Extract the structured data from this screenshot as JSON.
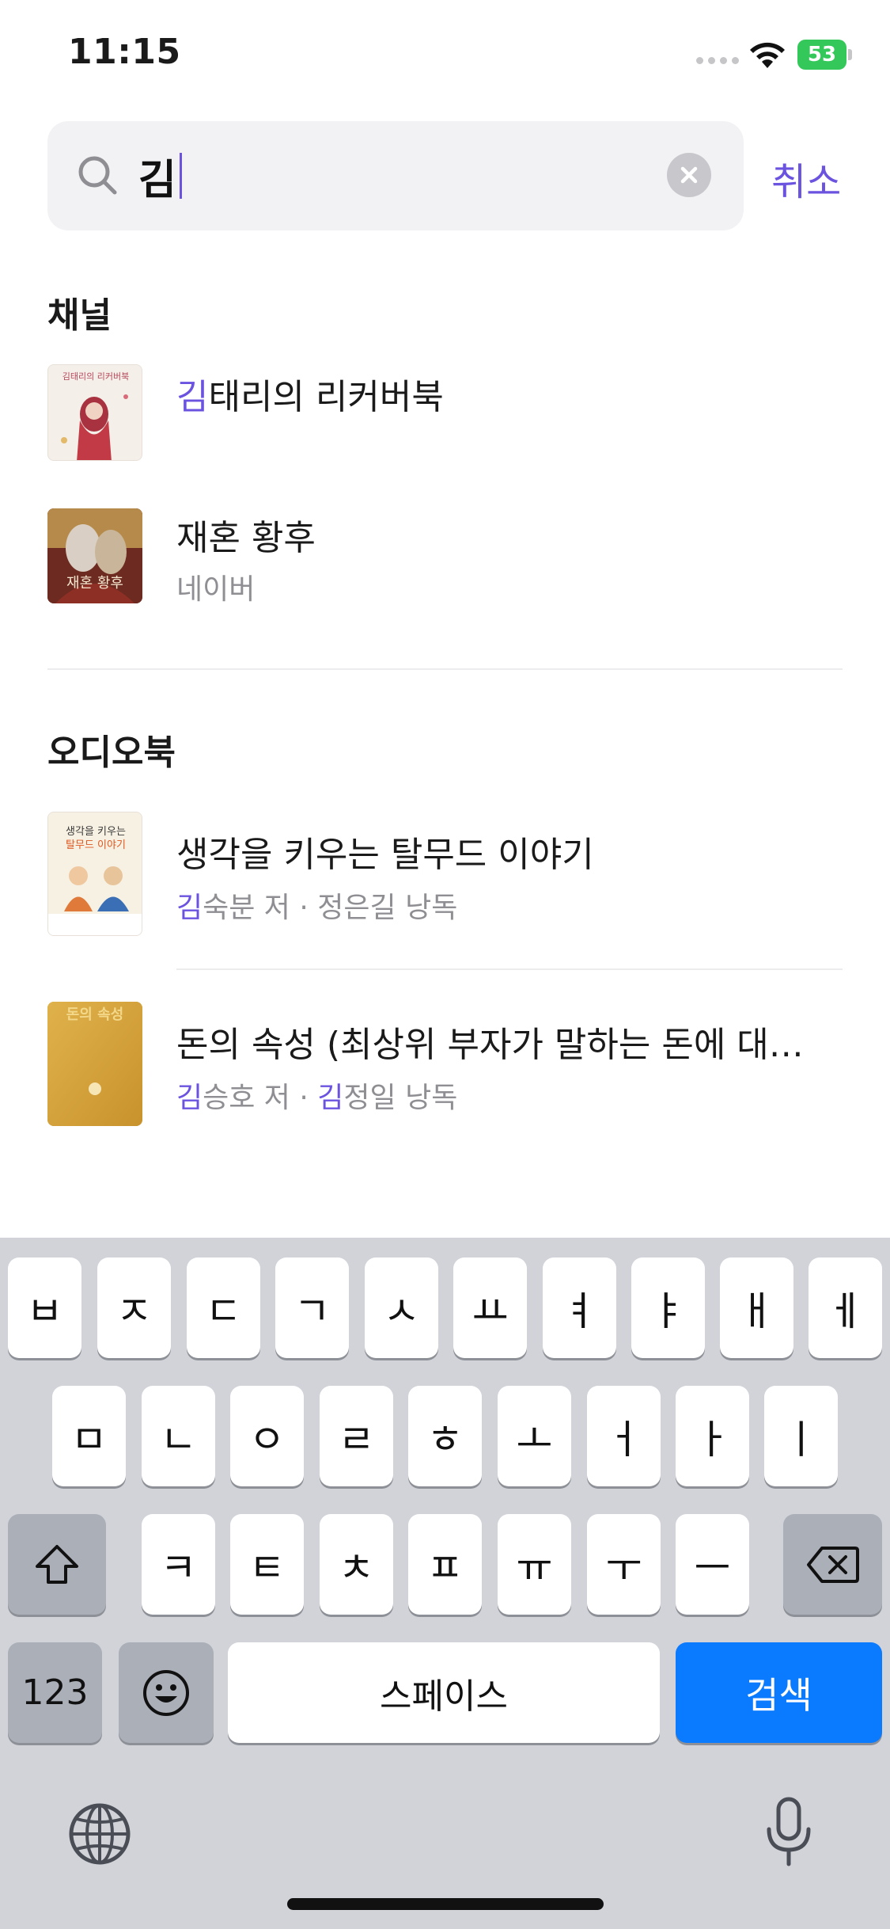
{
  "status_bar": {
    "time": "11:15",
    "battery": "53"
  },
  "search": {
    "query": "김",
    "cancel_label": "취소"
  },
  "channels": {
    "title": "채널",
    "items": [
      {
        "highlight": "김",
        "rest": "태리의 리커버북",
        "subtitle": ""
      },
      {
        "highlight": "",
        "rest": "재혼 황후",
        "subtitle": "네이버"
      }
    ]
  },
  "audiobooks": {
    "title": "오디오북",
    "items": [
      {
        "title": "생각을 키우는 탈무드 이야기",
        "author_hl": "김",
        "author_rest": "숙분 저",
        "sep": "·",
        "narrator_hl": "",
        "narrator_rest": "정은길 낭독"
      },
      {
        "title": "돈의 속성 (최상위 부자가 말하는 돈에 대한…",
        "author_hl": "김",
        "author_rest": "승호 저",
        "sep": "·",
        "narrator_hl": "김",
        "narrator_rest": "정일 낭독"
      }
    ]
  },
  "thumbnails": {
    "channel1_text": "김태리의 리커버북",
    "channel2_text": "재혼 황후",
    "book1_line1": "생각을 키우는",
    "book1_line2": "탈무드 이야기",
    "book2_text": "돈의 속성"
  },
  "keyboard": {
    "row1": [
      "ㅂ",
      "ㅈ",
      "ㄷ",
      "ㄱ",
      "ㅅ",
      "ㅛ",
      "ㅕ",
      "ㅑ",
      "ㅐ",
      "ㅔ"
    ],
    "row2": [
      "ㅁ",
      "ㄴ",
      "ㅇ",
      "ㄹ",
      "ㅎ",
      "ㅗ",
      "ㅓ",
      "ㅏ",
      "ㅣ"
    ],
    "row3": [
      "ㅋ",
      "ㅌ",
      "ㅊ",
      "ㅍ",
      "ㅠ",
      "ㅜ",
      "ㅡ"
    ],
    "numbers_label": "123",
    "space_label": "스페이스",
    "search_label": "검색"
  },
  "colors": {
    "accent": "#6b53e0",
    "keyboard_bg": "#d1d3d9",
    "search_key": "#0a7aff",
    "battery": "#34c759"
  }
}
